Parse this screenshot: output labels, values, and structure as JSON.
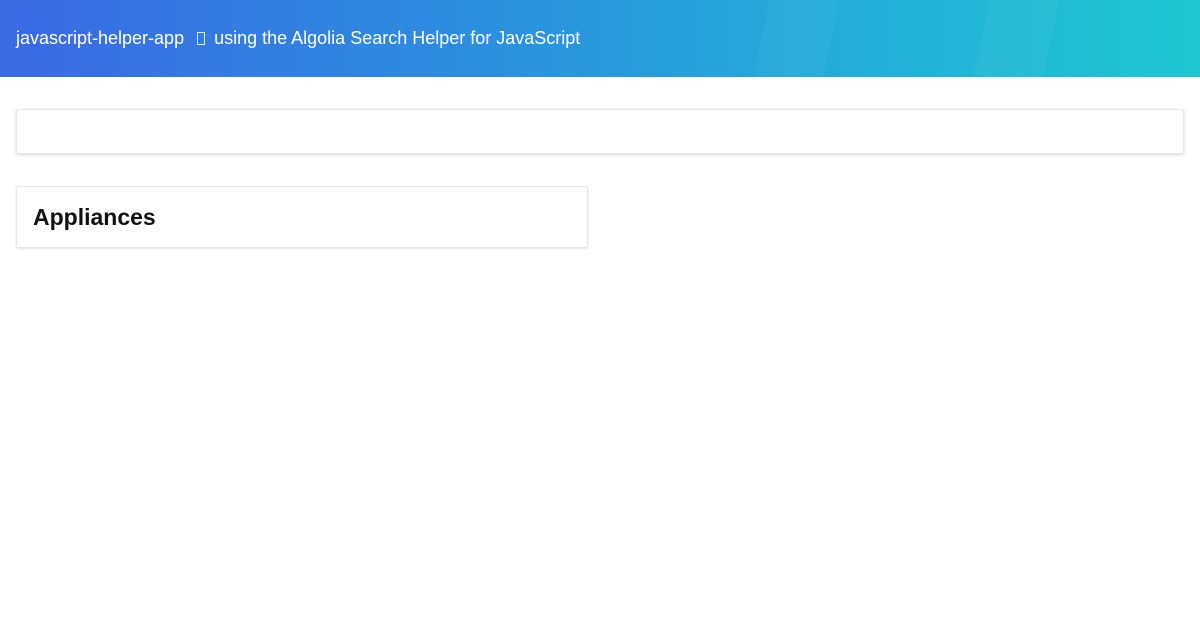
{
  "header": {
    "title": "javascript-helper-app",
    "separator_icon": "missing-glyph-icon",
    "subtitle": "using the Algolia Search Helper for JavaScript",
    "gradient": [
      "#3a69e4",
      "#1ec6d2"
    ]
  },
  "search": {
    "value": "",
    "placeholder": ""
  },
  "facet": {
    "title": "Appliances"
  }
}
